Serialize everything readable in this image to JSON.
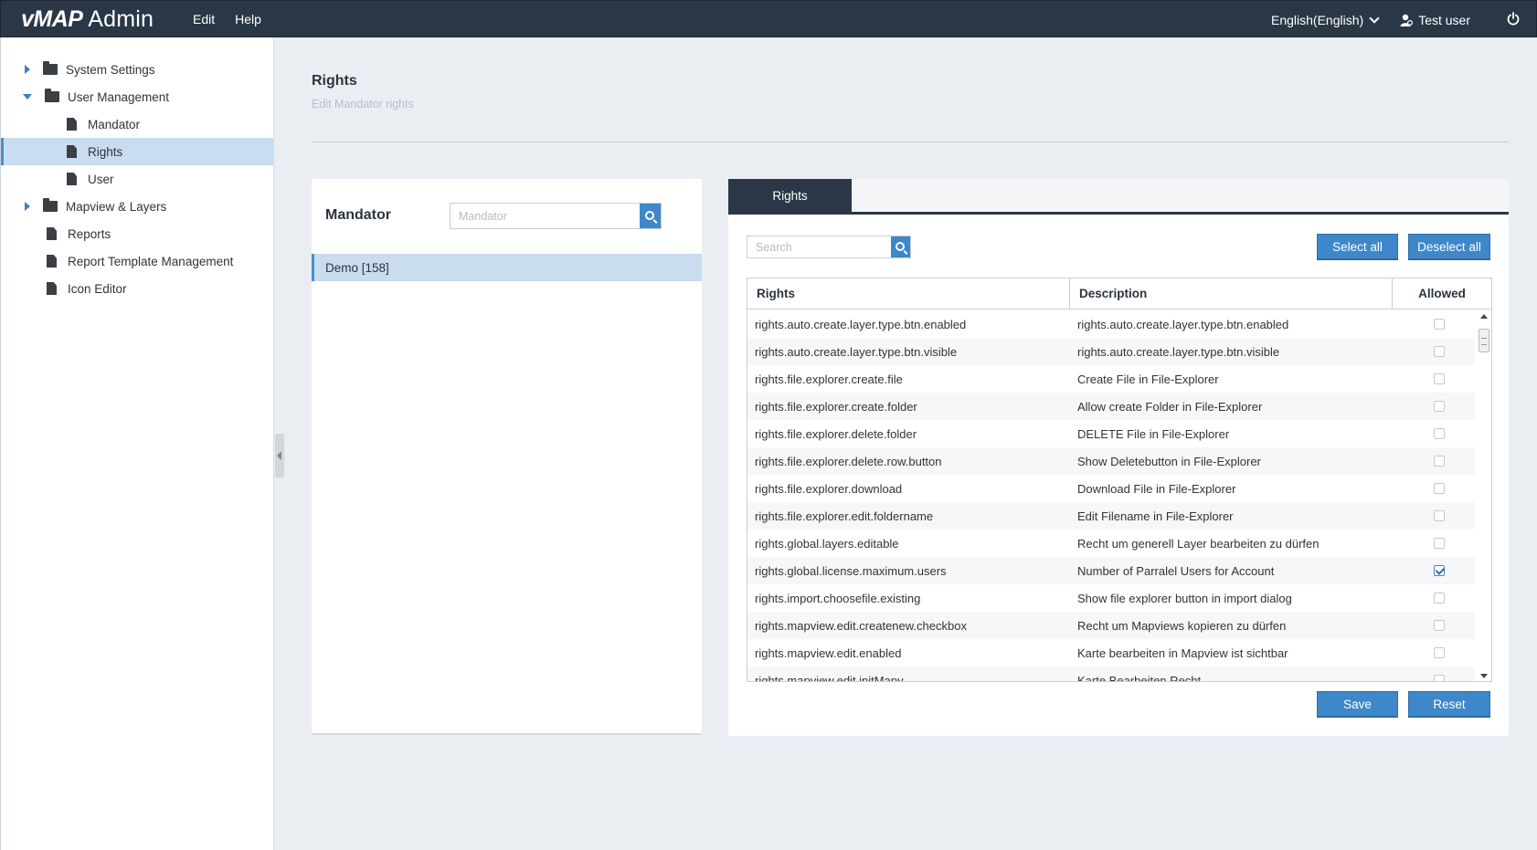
{
  "topbar": {
    "brand_main": "vMAP",
    "brand_sub": "Admin",
    "menu": [
      "Edit",
      "Help"
    ],
    "language": "English(English)",
    "user": "Test user"
  },
  "sidebar": {
    "items": [
      {
        "label": "System Settings",
        "type": "folder",
        "expanded": false
      },
      {
        "label": "User Management",
        "type": "folder",
        "expanded": true
      },
      {
        "label": "Mandator",
        "type": "file"
      },
      {
        "label": "Rights",
        "type": "file",
        "selected": true
      },
      {
        "label": "User",
        "type": "file"
      },
      {
        "label": "Mapview & Layers",
        "type": "folder",
        "expanded": false
      },
      {
        "label": "Reports",
        "type": "file"
      },
      {
        "label": "Report Template Management",
        "type": "file"
      },
      {
        "label": "Icon Editor",
        "type": "file"
      }
    ]
  },
  "page": {
    "title": "Rights",
    "subtitle": "Edit Mandator rights"
  },
  "mandator": {
    "title": "Mandator",
    "search_placeholder": "Mandator",
    "selected": "Demo [158]"
  },
  "rights": {
    "tab": "Rights",
    "search_placeholder": "Search",
    "select_all": "Select all",
    "deselect_all": "Deselect all",
    "columns": [
      "Rights",
      "Description",
      "Allowed"
    ],
    "rows": [
      {
        "right": "rights.auto.create.layer.type.btn.enabled",
        "description": "rights.auto.create.layer.type.btn.enabled",
        "allowed": false
      },
      {
        "right": "rights.auto.create.layer.type.btn.visible",
        "description": "rights.auto.create.layer.type.btn.visible",
        "allowed": false
      },
      {
        "right": "rights.file.explorer.create.file",
        "description": "Create File in File-Explorer",
        "allowed": false
      },
      {
        "right": "rights.file.explorer.create.folder",
        "description": "Allow create Folder in File-Explorer",
        "allowed": false
      },
      {
        "right": "rights.file.explorer.delete.folder",
        "description": "DELETE File in File-Explorer",
        "allowed": false
      },
      {
        "right": "rights.file.explorer.delete.row.button",
        "description": "Show Deletebutton in File-Explorer",
        "allowed": false
      },
      {
        "right": "rights.file.explorer.download",
        "description": "Download File in File-Explorer",
        "allowed": false
      },
      {
        "right": "rights.file.explorer.edit.foldername",
        "description": "Edit Filename in File-Explorer",
        "allowed": false
      },
      {
        "right": "rights.global.layers.editable",
        "description": "Recht um generell Layer bearbeiten zu dürfen",
        "allowed": false
      },
      {
        "right": "rights.global.license.maximum.users",
        "description": "Number of Parralel Users for Account",
        "allowed": true
      },
      {
        "right": "rights.import.choosefile.existing",
        "description": "Show file explorer button in import dialog",
        "allowed": false
      },
      {
        "right": "rights.mapview.edit.createnew.checkbox",
        "description": "Recht um Mapviews kopieren zu dürfen",
        "allowed": false
      },
      {
        "right": "rights.mapview.edit.enabled",
        "description": "Karte bearbeiten in Mapview ist sichtbar",
        "allowed": false
      },
      {
        "right": "rights.mapview.edit.initMapv",
        "description": "Karte Bearbeiten Recht",
        "allowed": false
      }
    ],
    "save": "Save",
    "reset": "Reset"
  }
}
